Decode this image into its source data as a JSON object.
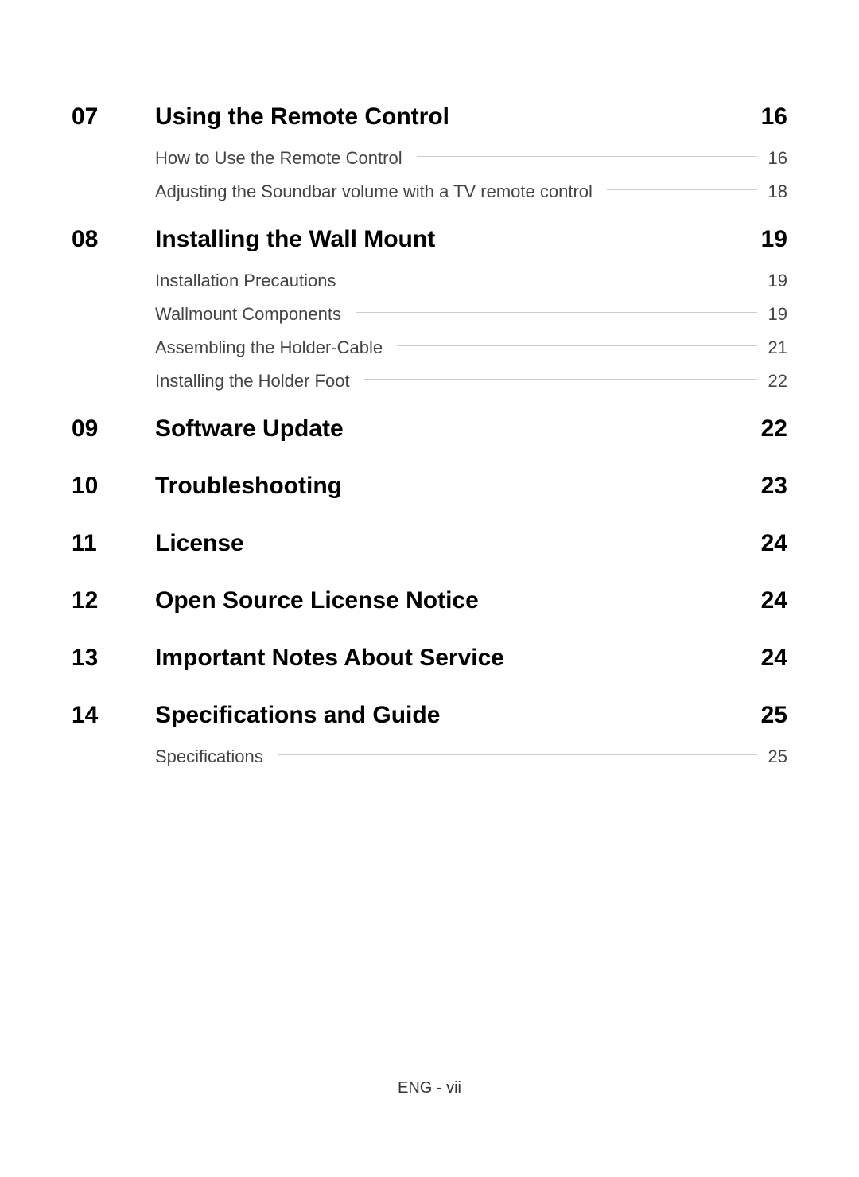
{
  "toc": [
    {
      "number": "07",
      "title": "Using the Remote Control",
      "page": "16",
      "subs": [
        {
          "title": "How to Use the Remote Control",
          "page": "16"
        },
        {
          "title": "Adjusting the Soundbar volume with a TV remote control",
          "page": "18"
        }
      ]
    },
    {
      "number": "08",
      "title": "Installing the Wall Mount",
      "page": "19",
      "subs": [
        {
          "title": "Installation Precautions",
          "page": "19"
        },
        {
          "title": "Wallmount Components",
          "page": "19"
        },
        {
          "title": "Assembling the Holder-Cable",
          "page": "21"
        },
        {
          "title": "Installing the Holder Foot",
          "page": "22"
        }
      ]
    },
    {
      "number": "09",
      "title": "Software Update",
      "page": "22",
      "subs": []
    },
    {
      "number": "10",
      "title": "Troubleshooting",
      "page": "23",
      "subs": []
    },
    {
      "number": "11",
      "title": "License",
      "page": "24",
      "subs": []
    },
    {
      "number": "12",
      "title": "Open Source License Notice",
      "page": "24",
      "subs": []
    },
    {
      "number": "13",
      "title": "Important Notes About Service",
      "page": "24",
      "subs": []
    },
    {
      "number": "14",
      "title": "Specifications and Guide",
      "page": "25",
      "subs": [
        {
          "title": "Specifications",
          "page": "25"
        }
      ]
    }
  ],
  "footer": "ENG - vii"
}
